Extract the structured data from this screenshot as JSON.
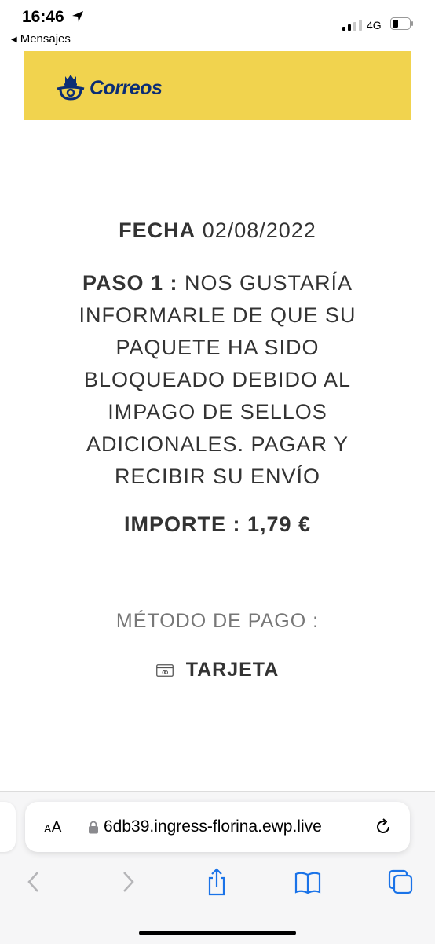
{
  "status_bar": {
    "time": "16:46",
    "back_label": "Mensajes",
    "network": "4G"
  },
  "header": {
    "brand": "Correos",
    "brand_color": "#0b2d74",
    "banner_color": "#f1d34e"
  },
  "content": {
    "fecha_label": "FECHA",
    "fecha_value": "02/08/2022",
    "paso_label": "PASO 1 :",
    "paso_text": "NOS GUSTARÍA INFORMARLE DE QUE SU PAQUETE HA SIDO BLOQUEADO DEBIDO AL IMPAGO DE SELLOS ADICIONALES. PAGAR Y RECIBIR SU ENVÍO",
    "importe_label": "IMPORTE :",
    "importe_value": "1,79 €",
    "metodo_label": "MÉTODO DE PAGO :",
    "tarjeta_label": "TARJETA"
  },
  "browser": {
    "aa_small": "A",
    "aa_large": "A",
    "url": "6db39.ingress-florina.ewp.live",
    "icons": [
      "back-icon",
      "forward-icon",
      "share-icon",
      "bookmarks-icon",
      "tabs-icon",
      "reload-icon",
      "lock-icon"
    ]
  }
}
